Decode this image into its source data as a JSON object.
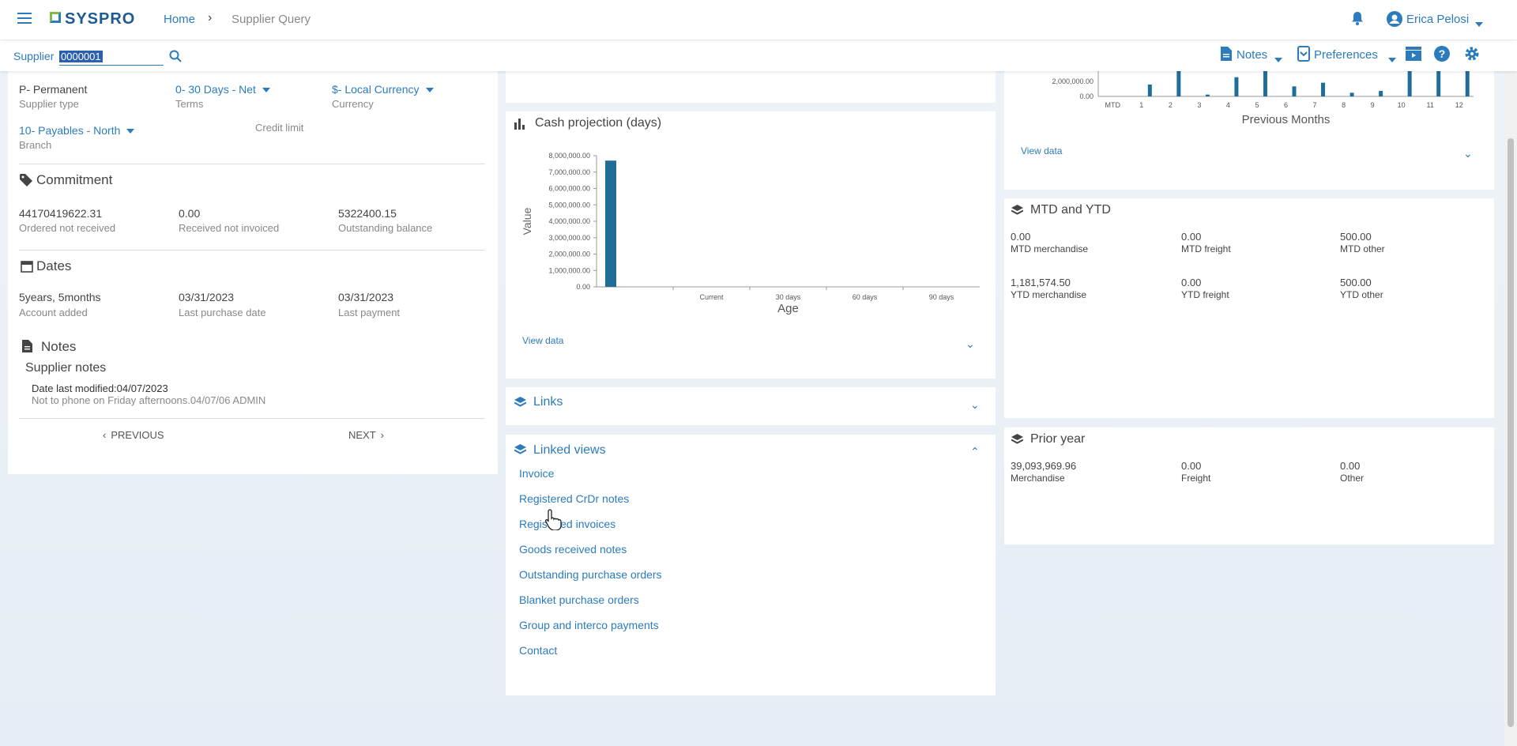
{
  "header": {
    "logo": "SYSPRO",
    "breadcrumb_home": "Home",
    "breadcrumb_current": "Supplier Query",
    "user": "Erica Pelosi"
  },
  "toolbar": {
    "supplier_label": "Supplier",
    "supplier_value": "0000001",
    "notes_label": "Notes",
    "preferences_label": "Preferences"
  },
  "details": {
    "supplier_type_value": "P- Permanent",
    "supplier_type_label": "Supplier type",
    "terms_value": "0- 30 Days - Net",
    "terms_label": "Terms",
    "currency_value": "$- Local Currency",
    "currency_label": "Currency",
    "branch_value": "10- Payables - North",
    "branch_label": "Branch",
    "credit_limit_label": "Credit limit"
  },
  "commitment": {
    "title": "Commitment",
    "ordered_value": "44170419622.31",
    "ordered_label": "Ordered not received",
    "received_value": "0.00",
    "received_label": "Received not invoiced",
    "outstanding_value": "5322400.15",
    "outstanding_label": "Outstanding balance"
  },
  "dates": {
    "title": "Dates",
    "account_added_value": "5years, 5months",
    "account_added_label": "Account added",
    "last_purchase_value": "03/31/2023",
    "last_purchase_label": "Last purchase date",
    "last_payment_value": "03/31/2023",
    "last_payment_label": "Last payment"
  },
  "notes": {
    "title": "Notes",
    "subtitle": "Supplier notes",
    "modified": "Date last modified:04/07/2023",
    "text": "Not to phone on Friday afternoons.04/07/06 ADMIN"
  },
  "pager": {
    "previous": "PREVIOUS",
    "next": "NEXT"
  },
  "cash_projection": {
    "title": "Cash projection (days)",
    "view_data": "View data"
  },
  "links": {
    "title": "Links"
  },
  "linked_views": {
    "title": "Linked views",
    "items": [
      "Invoice",
      "Registered CrDr notes",
      "Registered invoices",
      "Goods received notes",
      "Outstanding purchase orders",
      "Blanket purchase orders",
      "Group and interco payments",
      "Contact"
    ]
  },
  "prev_months": {
    "view_data": "View data"
  },
  "mtd_ytd": {
    "title": "MTD and YTD",
    "mtd_merch_value": "0.00",
    "mtd_merch_label": "MTD merchandise",
    "mtd_freight_value": "0.00",
    "mtd_freight_label": "MTD freight",
    "mtd_other_value": "500.00",
    "mtd_other_label": "MTD other",
    "ytd_merch_value": "1,181,574.50",
    "ytd_merch_label": "YTD merchandise",
    "ytd_freight_value": "0.00",
    "ytd_freight_label": "YTD freight",
    "ytd_other_value": "500.00",
    "ytd_other_label": "YTD other"
  },
  "prior_year": {
    "title": "Prior year",
    "merch_value": "39,093,969.96",
    "merch_label": "Merchandise",
    "freight_value": "0.00",
    "freight_label": "Freight",
    "other_value": "0.00",
    "other_label": "Other"
  },
  "chart_data": [
    {
      "type": "bar",
      "ylabel": "Value",
      "xlabel": "Age",
      "categories": [
        "",
        "Current",
        "30 days",
        "60 days",
        "90 days"
      ],
      "values": [
        7700000,
        0,
        0,
        0,
        0
      ],
      "ylim": [
        0,
        8000000
      ],
      "yticks": [
        "8,000,000.00",
        "7,000,000.00",
        "6,000,000.00",
        "5,000,000.00",
        "4,000,000.00",
        "3,000,000.00",
        "2,000,000.00",
        "1,000,000.00",
        "0.00"
      ]
    },
    {
      "type": "bar",
      "xlabel": "Previous Months",
      "categories": [
        "MTD",
        "1",
        "2",
        "3",
        "4",
        "5",
        "6",
        "7",
        "8",
        "9",
        "10",
        "11",
        "12"
      ],
      "values": [
        0,
        1300000,
        4500000,
        200000,
        2100000,
        4500000,
        1100000,
        1500000,
        400000,
        600000,
        4500000,
        4500000,
        4500000
      ],
      "yticks": [
        "2,000,000.00",
        "0.00"
      ]
    }
  ],
  "colors": {
    "accent": "#2b7bbd",
    "bar": "#1f6e99"
  }
}
